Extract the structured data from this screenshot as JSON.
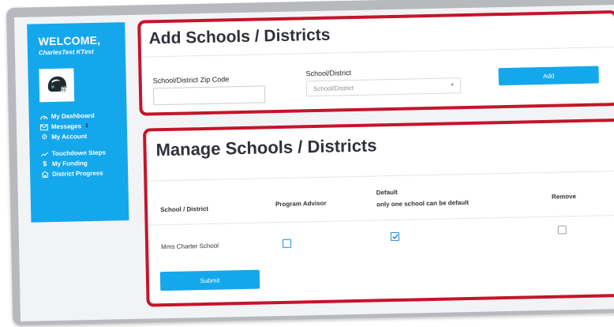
{
  "sidebar": {
    "welcome": "WELCOME,",
    "user_name": "CharlesTest KTest",
    "groups": [
      [
        {
          "label": "My Dashboard",
          "icon": "dashboard-icon"
        },
        {
          "label": "Messages",
          "icon": "mail-icon",
          "badge": "1"
        },
        {
          "label": "My Account",
          "icon": "gear-icon"
        }
      ],
      [
        {
          "label": "Touchdown Steps",
          "icon": "trend-icon"
        },
        {
          "label": "My Funding",
          "icon": "dollar-icon"
        },
        {
          "label": "District Progress",
          "icon": "school-icon"
        }
      ]
    ]
  },
  "add_section": {
    "title": "Add Schools / Districts",
    "zip_label": "School/District Zip Code",
    "zip_value": "",
    "district_label": "School/District",
    "district_placeholder": "School/District",
    "add_button": "Add"
  },
  "manage_section": {
    "title": "Manage Schools / Districts",
    "columns": {
      "school": "School / District",
      "advisor": "Program Advisor",
      "default": "Default",
      "default_note": "only one school can be default",
      "remove": "Remove"
    },
    "rows": [
      {
        "school": "Mms Charter School",
        "advisor": false,
        "default": true,
        "remove": false
      }
    ],
    "submit_button": "Submit"
  },
  "colors": {
    "accent": "#14a7ec",
    "highlight": "#c4152b"
  }
}
